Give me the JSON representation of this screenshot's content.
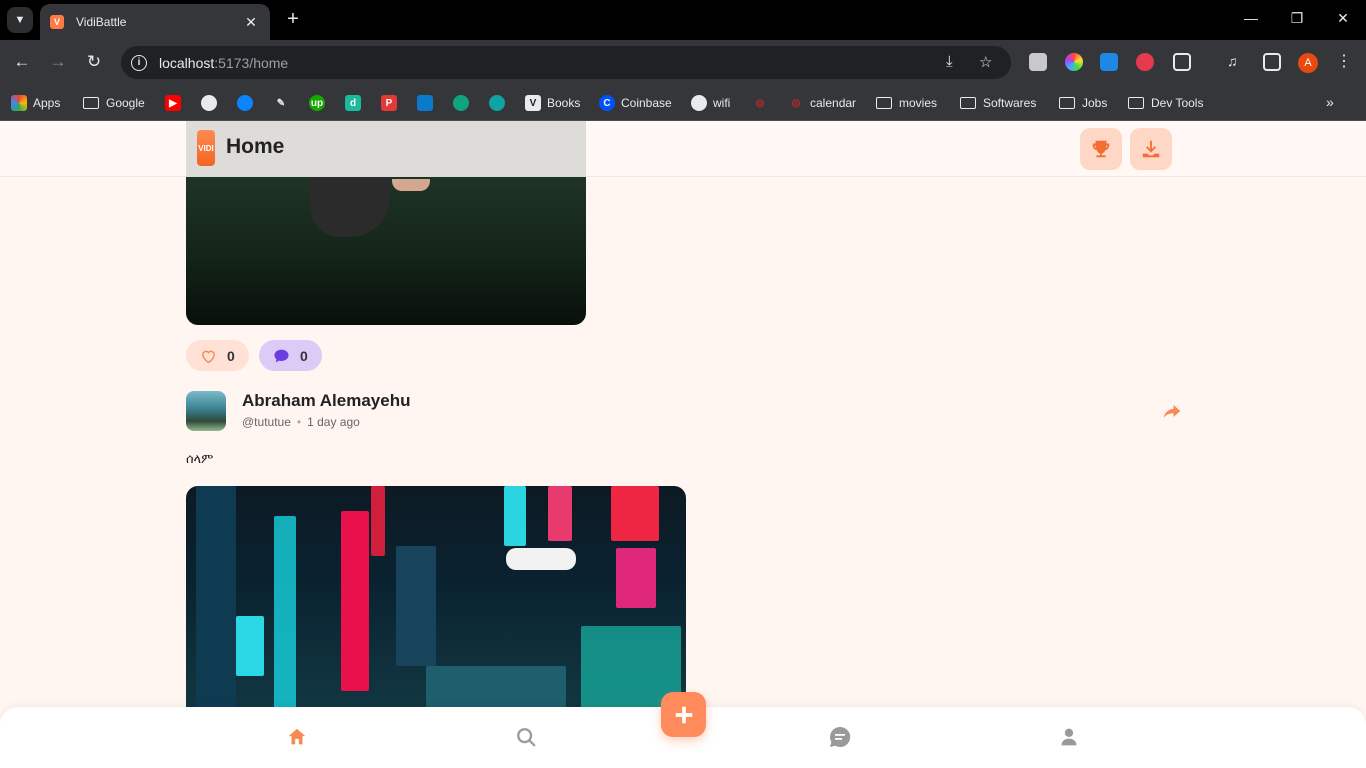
{
  "browser": {
    "tab_title": "VidiBattle",
    "url_host": "localhost",
    "url_path": ":5173/home",
    "profile_initial": "A",
    "bookmarks": [
      "Apps",
      "Google",
      "Books",
      "Coinbase",
      "wifi",
      "calendar",
      "movies",
      "Softwares",
      "Jobs",
      "Dev Tools"
    ]
  },
  "app": {
    "logo_text": "VIDI",
    "page_title": "Home"
  },
  "post_prev": {
    "likes": "0",
    "comments": "0"
  },
  "post": {
    "author_name": "Abraham Alemayehu",
    "handle": "@tututue",
    "time": "1 day ago",
    "caption": "ሰላም"
  },
  "colors": {
    "accent": "#f58a53",
    "page_bg": "#fff6f2",
    "like_pill": "#ffe1d6",
    "comment_pill": "#dccbf7"
  },
  "icons": {
    "trophy": "trophy-icon",
    "download": "download-icon",
    "heart": "heart-icon",
    "comment": "comment-icon",
    "share": "share-icon",
    "home": "home-icon",
    "search": "search-icon",
    "chat": "chat-icon",
    "profile": "user-icon",
    "add": "plus-icon"
  }
}
